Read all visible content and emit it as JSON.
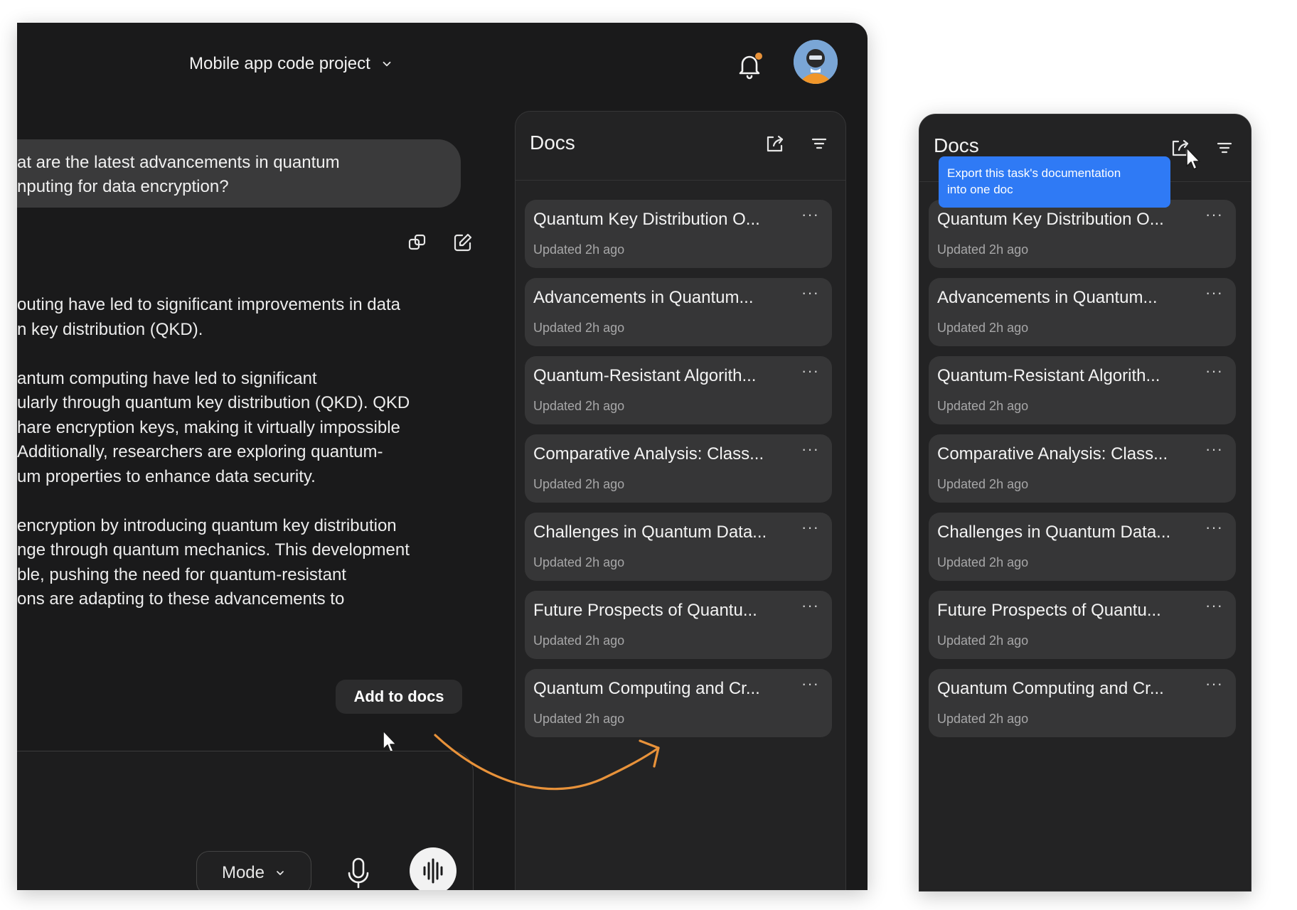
{
  "header": {
    "project_title": "Mobile app code project"
  },
  "chat": {
    "user_message": "at are the latest advancements in quantum\nnputing for data encryption?",
    "response_text": "outing have led to significant improvements in data\nn key distribution (QKD).\n\nantum computing have led to significant\nularly through quantum key distribution (QKD). QKD\nhare encryption keys, making it virtually impossible\nAdditionally, researchers are exploring quantum-\num properties to enhance data security.\n\nencryption by introducing quantum key distribution\nnge through quantum mechanics. This development\nble, pushing the need for quantum-resistant\nons are adapting to these advancements to",
    "add_to_docs_label": "Add to docs"
  },
  "composer": {
    "mode_label": "Mode"
  },
  "docs_panel": {
    "title": "Docs",
    "tooltip": "Export this task's documentation\ninto one doc",
    "items": [
      {
        "title": "Quantum Key Distribution O...",
        "updated": "Updated 2h ago",
        "more": "···"
      },
      {
        "title": "Advancements in Quantum...",
        "updated": "Updated 2h ago",
        "more": "···"
      },
      {
        "title": "Quantum-Resistant Algorith...",
        "updated": "Updated 2h ago",
        "more": "···"
      },
      {
        "title": "Comparative Analysis: Class...",
        "updated": "Updated 2h ago",
        "more": "···"
      },
      {
        "title": "Challenges in Quantum Data...",
        "updated": "Updated 2h ago",
        "more": "···"
      },
      {
        "title": "Future Prospects of Quantu...",
        "updated": "Updated 2h ago",
        "more": "···"
      },
      {
        "title": "Quantum Computing and Cr...",
        "updated": "Updated 2h ago",
        "more": "···"
      }
    ]
  },
  "colors": {
    "app_background": "#1a1a1b",
    "panel_background": "#232324",
    "card_background": "#363637",
    "accent_orange": "#e8923a",
    "tooltip_blue": "#2f7af5"
  },
  "icons": [
    "chevron-down-icon",
    "bell-icon",
    "avatar",
    "copy-icon",
    "edit-icon",
    "cursor-icon",
    "arrow-icon",
    "export-icon",
    "filter-icon",
    "more-icon",
    "mic-icon",
    "waveform-icon"
  ]
}
